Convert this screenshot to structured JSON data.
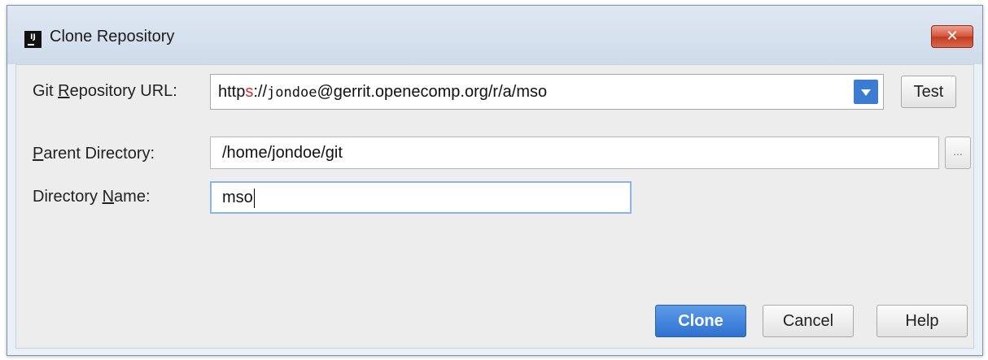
{
  "window": {
    "title": "Clone Repository",
    "app_icon_glyph": "IJ",
    "close_glyph": "✕"
  },
  "form": {
    "repo_url_label_pre": "Git ",
    "repo_url_label_ul": "R",
    "repo_url_label_post": "epository URL:",
    "repo_url": {
      "part1": "http",
      "part2": "s",
      "part3": "://",
      "part4": "jondoe",
      "part5": "@gerrit.openecomp.org/r/a/mso"
    },
    "test_label": "Test",
    "parent_dir_label_ul": "P",
    "parent_dir_label_post": "arent Directory:",
    "parent_dir_value": "/home/jondoe/git",
    "browse_label": "...",
    "dir_name_label_pre": "Directory ",
    "dir_name_label_ul": "N",
    "dir_name_label_post": "ame:",
    "dir_name_value": "mso"
  },
  "buttons": {
    "clone": "Clone",
    "cancel": "Cancel",
    "help": "Help"
  },
  "colors": {
    "accent": "#2f72cf",
    "url_highlight": "#d3312a"
  },
  "icons": {
    "dropdown": "chevron-down-icon",
    "close": "close-icon",
    "app": "intellij-icon"
  }
}
